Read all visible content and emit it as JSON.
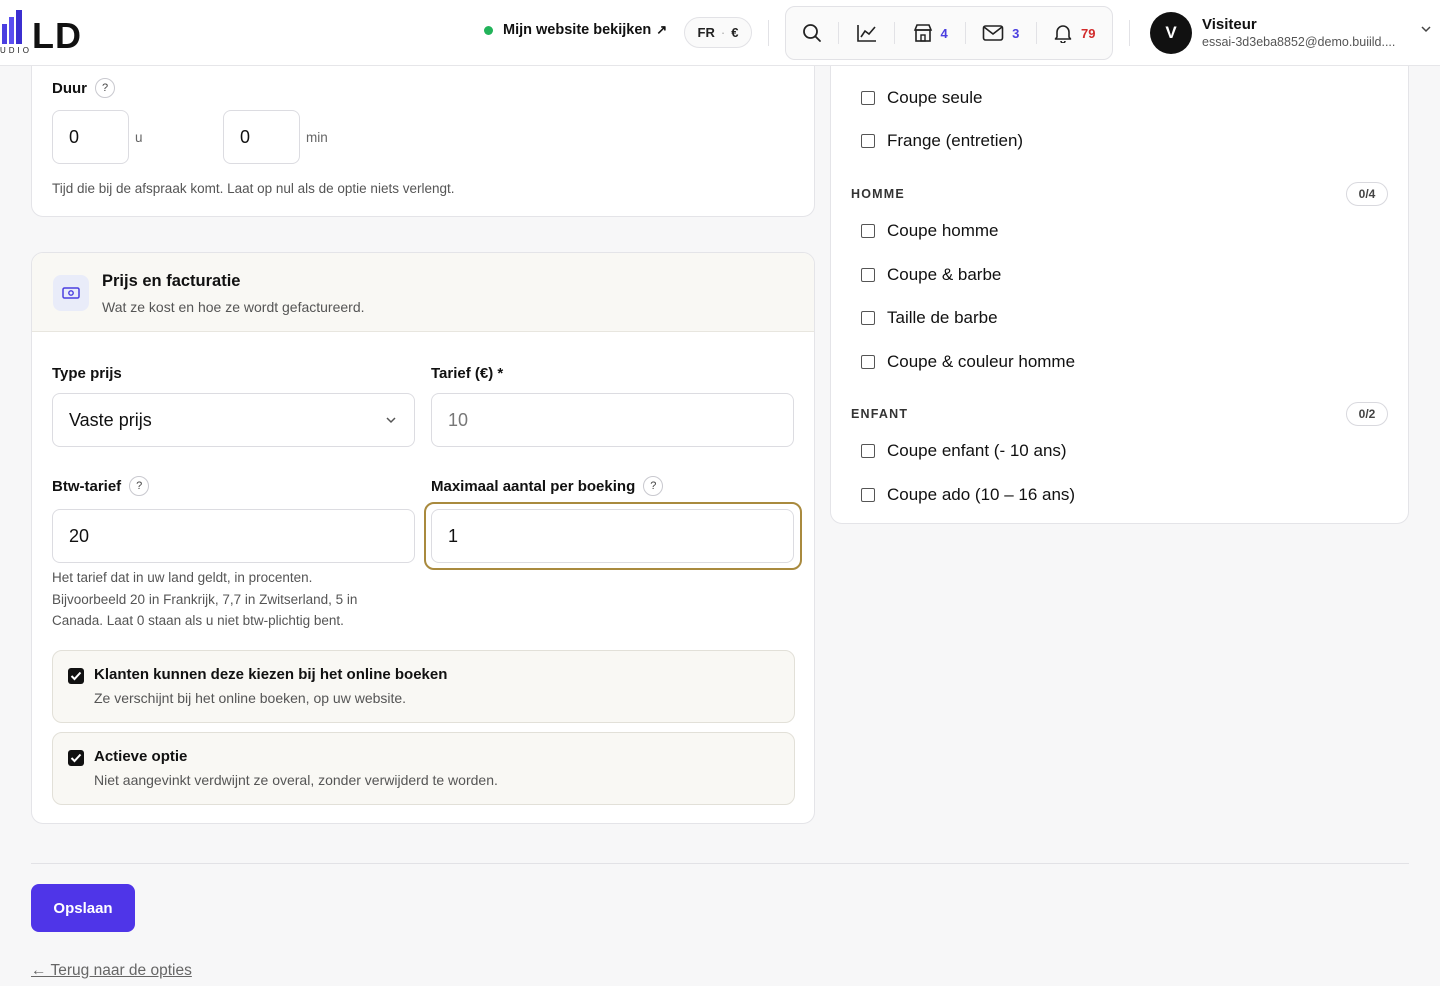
{
  "header": {
    "logo_text": "LD",
    "logo_sub": "UDIO",
    "view_site_label": "Mijn website bekijken",
    "lang": "FR",
    "currency": "€",
    "badges": {
      "shop": "4",
      "mail": "3",
      "notifications": "79"
    },
    "user_initial": "V",
    "user_name": "Visiteur",
    "user_email": "essai-3d3eba8852@demo.buiild...."
  },
  "duur": {
    "label": "Duur",
    "hours_value": "0",
    "hours_unit": "u",
    "minutes_value": "0",
    "minutes_unit": "min",
    "hint": "Tijd die bij de afspraak komt. Laat op nul als de optie niets verlengt."
  },
  "prijs": {
    "title": "Prijs en facturatie",
    "subtitle": "Wat ze kost en hoe ze wordt gefactureerd.",
    "type_label": "Type prijs",
    "type_value": "Vaste prijs",
    "tarief_label": "Tarief (€) *",
    "tarief_value": "10",
    "btw_label": "Btw-tarief",
    "btw_value": "20",
    "max_label": "Maximaal aantal per boeking",
    "max_value": "1",
    "btw_hint_1": "Het tarief dat in uw land geldt, in procenten.",
    "btw_hint_2": "Bijvoorbeeld 20 in Frankrijk, 7,7 in Zwitserland, 5 in",
    "btw_hint_3": "Canada. Laat 0 staan als u niet btw-plichtig bent.",
    "online_title": "Klanten kunnen deze kiezen bij het online boeken",
    "online_sub": "Ze verschijnt bij het online boeken, op uw website.",
    "active_title": "Actieve optie",
    "active_sub": "Niet aangevinkt verdwijnt ze overal, zonder verwijderd te worden."
  },
  "services": {
    "top_items": [
      "Coupe seule",
      "Frange (entretien)"
    ],
    "homme": {
      "title": "HOMME",
      "count": "0/4",
      "items": [
        "Coupe homme",
        "Coupe & barbe",
        "Taille de barbe",
        "Coupe & couleur homme"
      ]
    },
    "enfant": {
      "title": "ENFANT",
      "count": "0/2",
      "items": [
        "Coupe enfant (- 10 ans)",
        "Coupe ado (10 – 16 ans)"
      ]
    }
  },
  "footer": {
    "save_label": "Opslaan",
    "back_label": "← Terug naar de opties"
  },
  "colors": {
    "accent": "#4f35e8",
    "focus": "#a98a3e",
    "badge_blue": "#4a3ee0",
    "badge_red": "#d22b2b",
    "online_dot": "#22b35a"
  }
}
